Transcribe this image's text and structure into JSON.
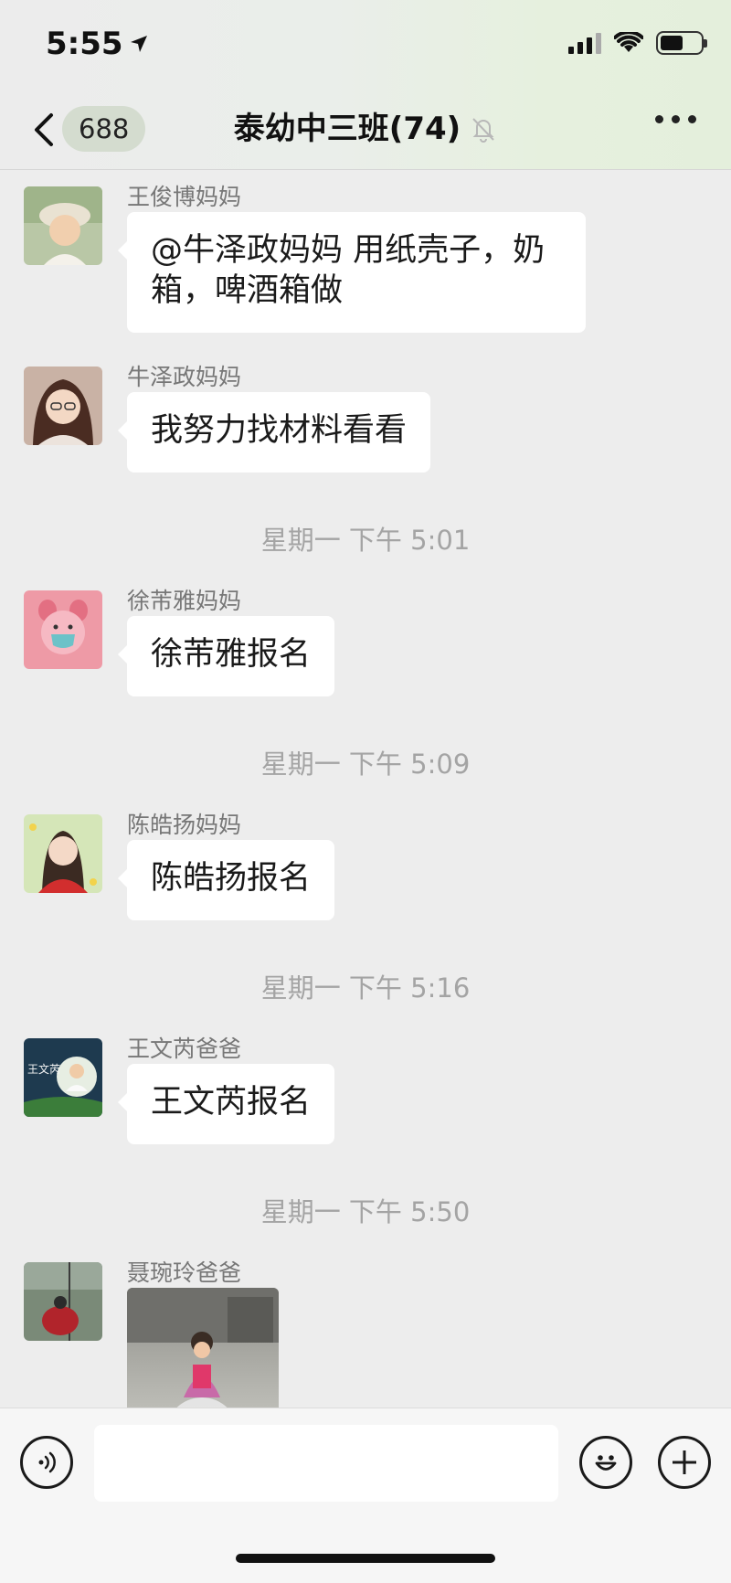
{
  "status_bar": {
    "time": "5:55"
  },
  "nav": {
    "unread_count": "688",
    "title": "泰幼中三班(74)"
  },
  "messages": [
    {
      "sender": "王俊博妈妈",
      "text_line1": "@牛泽政妈妈 用纸壳子，奶",
      "text_line2": "箱，啤酒箱做"
    },
    {
      "sender": "牛泽政妈妈",
      "text": "我努力找材料看看"
    },
    {
      "sender": "徐芾雅妈妈",
      "text": "徐芾雅报名"
    },
    {
      "sender": "陈皓扬妈妈",
      "text": "陈皓扬报名"
    },
    {
      "sender": "王文芮爸爸",
      "text": "王文芮报名"
    },
    {
      "sender": "聂琬玲爸爸"
    }
  ],
  "timestamps": [
    "星期一 下午 5:01",
    "星期一 下午 5:09",
    "星期一 下午 5:16",
    "星期一 下午 5:50"
  ],
  "avatar_text": {
    "name_card": "王文芮"
  },
  "input": {
    "value": ""
  },
  "colors": {
    "background": "#ededed",
    "bubble": "#ffffff",
    "muted_text": "#a4a4a4"
  }
}
